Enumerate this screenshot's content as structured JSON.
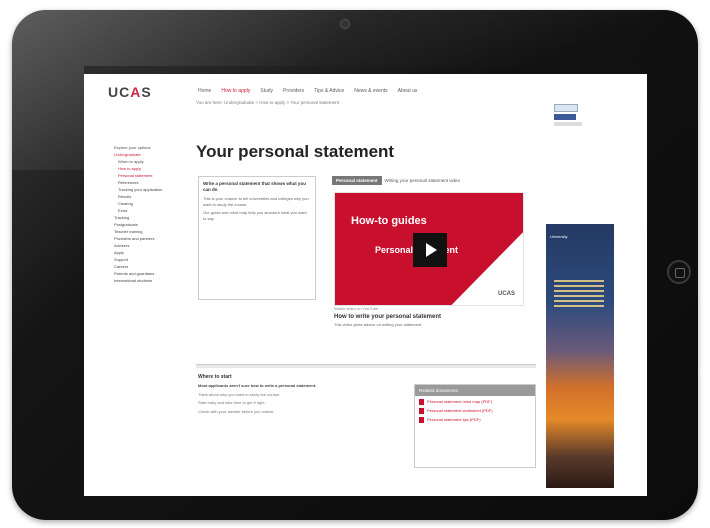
{
  "site": {
    "logo_prefix": "UC",
    "logo_accent": "A",
    "logo_suffix": "S"
  },
  "topnav": [
    "Home",
    "How to apply",
    "Study",
    "Providers",
    "Tips & Advice",
    "News & events",
    "About us"
  ],
  "breadcrumb": "You are here: Undergraduate > How to apply > Your personal statement",
  "page": {
    "title": "Your personal statement"
  },
  "leftnav": [
    "Explore your options",
    "Undergraduate",
    "When to apply",
    "How to apply",
    "Personal statement",
    "References",
    "Tracking your application",
    "Results",
    "Clearing",
    "Extra",
    "Tracking",
    "Postgraduate",
    "Teacher training",
    "Providers and partners",
    "Advisers",
    "Apply",
    "Support",
    "Careers",
    "Parents and guardians",
    "International students"
  ],
  "intro": {
    "heading": "Write a personal statement that shows what you can do",
    "body1": "This is your chance to tell universities and colleges why you want to study the course.",
    "body2": "Our guide and mind map help you structure what you want to say."
  },
  "video": {
    "tab_active": "Personal statement",
    "tab_other": "Writing your personal statement video",
    "banner_title": "How-to guides",
    "banner_sub": "Personal statement",
    "brand": "UCAS",
    "caption_small": "Watch video on YouTube",
    "caption_title": "How to write your personal statement",
    "caption_body": "This video gives advice on writing your statement."
  },
  "advert": {
    "brand": "University"
  },
  "where_to_start": {
    "heading": "Where to start",
    "lead": "Most applicants aren't sure how to write a personal statement.",
    "body1": "Think about why you want to study the course.",
    "body2": "Start early and take time to get it right.",
    "body3": "Check with your adviser before you submit."
  },
  "related": {
    "heading": "Related documents",
    "items": [
      "Personal statement mind map (PDF)",
      "Personal statement worksheet (PDF)",
      "Personal statement tips (PDF)"
    ]
  }
}
